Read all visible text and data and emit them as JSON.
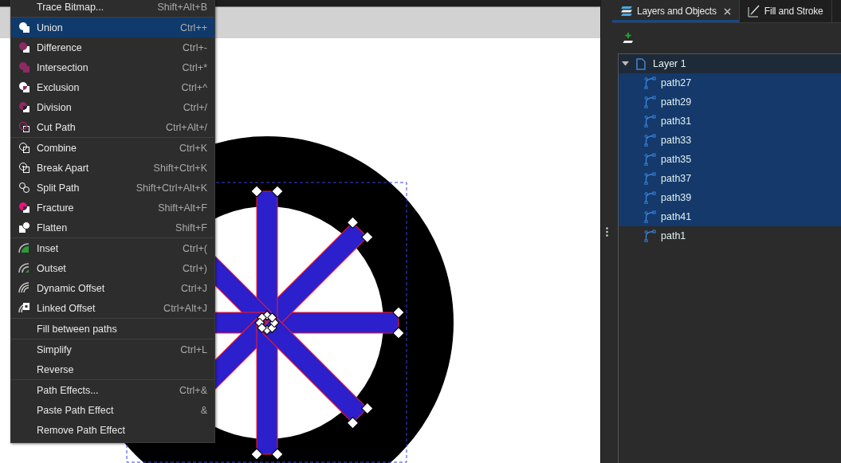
{
  "menu": {
    "sections": [
      {
        "items": [
          {
            "label": "Trace Bitmap...",
            "shortcut": "Shift+Alt+B",
            "selected": false
          }
        ]
      },
      {
        "items": [
          {
            "label": "Union",
            "shortcut": "Ctrl++",
            "selected": true
          },
          {
            "label": "Difference",
            "shortcut": "Ctrl+-",
            "selected": false
          },
          {
            "label": "Intersection",
            "shortcut": "Ctrl+*",
            "selected": false
          },
          {
            "label": "Exclusion",
            "shortcut": "Ctrl+^",
            "selected": false
          },
          {
            "label": "Division",
            "shortcut": "Ctrl+/",
            "selected": false
          },
          {
            "label": "Cut Path",
            "shortcut": "Ctrl+Alt+/",
            "selected": false
          }
        ]
      },
      {
        "items": [
          {
            "label": "Combine",
            "shortcut": "Ctrl+K",
            "selected": false
          },
          {
            "label": "Break Apart",
            "shortcut": "Shift+Ctrl+K",
            "selected": false
          },
          {
            "label": "Split Path",
            "shortcut": "Shift+Ctrl+Alt+K",
            "selected": false
          },
          {
            "label": "Fracture",
            "shortcut": "Shift+Alt+F",
            "selected": false
          },
          {
            "label": "Flatten",
            "shortcut": "Shift+F",
            "selected": false
          }
        ]
      },
      {
        "items": [
          {
            "label": "Inset",
            "shortcut": "Ctrl+(",
            "selected": false
          },
          {
            "label": "Outset",
            "shortcut": "Ctrl+)",
            "selected": false
          },
          {
            "label": "Dynamic Offset",
            "shortcut": "Ctrl+J",
            "selected": false
          },
          {
            "label": "Linked Offset",
            "shortcut": "Ctrl+Alt+J",
            "selected": false
          }
        ]
      },
      {
        "items": [
          {
            "label": "Fill between paths",
            "selected": false
          }
        ]
      },
      {
        "items": [
          {
            "label": "Simplify",
            "shortcut": "Ctrl+L",
            "selected": false
          },
          {
            "label": "Reverse",
            "selected": false
          }
        ]
      },
      {
        "items": [
          {
            "label": "Path Effects...",
            "shortcut": "Ctrl+&",
            "selected": false
          },
          {
            "label": "Paste Path Effect",
            "shortcut": "&",
            "selected": false
          },
          {
            "label": "Remove Path Effect",
            "selected": false
          }
        ]
      }
    ]
  },
  "panel": {
    "tabs": [
      {
        "label": "Layers and Objects",
        "selected": true,
        "closable": true
      },
      {
        "label": "Fill and Stroke",
        "selected": false,
        "closable": false
      }
    ],
    "tree": {
      "label": "Layer 1",
      "expanded": true,
      "selected": false,
      "children": [
        {
          "label": "path27",
          "selected": true
        },
        {
          "label": "path29",
          "selected": true
        },
        {
          "label": "path31",
          "selected": true
        },
        {
          "label": "path33",
          "selected": true
        },
        {
          "label": "path35",
          "selected": true
        },
        {
          "label": "path37",
          "selected": true
        },
        {
          "label": "path39",
          "selected": true
        },
        {
          "label": "path41",
          "selected": true
        },
        {
          "label": "path1",
          "selected": false
        }
      ]
    }
  }
}
